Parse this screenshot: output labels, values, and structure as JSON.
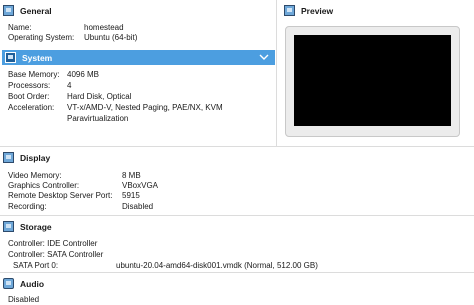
{
  "general": {
    "title": "General",
    "rows": [
      {
        "label": "Name:",
        "value": "homestead"
      },
      {
        "label": "Operating System:",
        "value": "Ubuntu (64-bit)"
      }
    ]
  },
  "preview": {
    "title": "Preview"
  },
  "system": {
    "title": "System",
    "rows": [
      {
        "label": "Base Memory:",
        "value": "4096 MB"
      },
      {
        "label": "Processors:",
        "value": "4"
      },
      {
        "label": "Boot Order:",
        "value": "Hard Disk, Optical"
      },
      {
        "label": "Acceleration:",
        "value": "VT-x/AMD-V, Nested Paging, PAE/NX, KVM"
      },
      {
        "label": "",
        "value": "Paravirtualization"
      }
    ]
  },
  "display": {
    "title": "Display",
    "rows": [
      {
        "label": "Video Memory:",
        "value": "8 MB"
      },
      {
        "label": "Graphics Controller:",
        "value": "VBoxVGA"
      },
      {
        "label": "Remote Desktop Server Port:",
        "value": "5915"
      },
      {
        "label": "Recording:",
        "value": "Disabled"
      }
    ]
  },
  "storage": {
    "title": "Storage",
    "rows": [
      {
        "label": "Controller: IDE Controller",
        "value": ""
      },
      {
        "label": "Controller: SATA Controller",
        "value": ""
      },
      {
        "label": "SATA Port 0:",
        "value": "ubuntu-20.04-amd64-disk001.vmdk (Normal, 512.00 GB)"
      }
    ]
  },
  "audio": {
    "title": "Audio",
    "rows": [
      {
        "label": "Disabled",
        "value": ""
      }
    ]
  },
  "colors": {
    "selected_header": "#4c9ee0",
    "background": "#ffffff",
    "separator": "#dcdcdc",
    "preview_screen": "#000000"
  },
  "icons": {
    "general": "monitor-icon",
    "preview": "monitor-icon",
    "system": "chip-icon",
    "display": "display-icon",
    "storage": "disk-icon",
    "audio": "speaker-icon",
    "collapse": "chevron-down-icon"
  }
}
